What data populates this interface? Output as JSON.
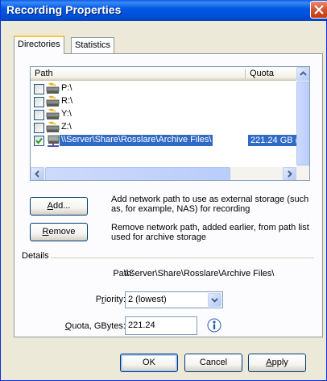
{
  "window": {
    "title": "Recording Properties"
  },
  "tabs": [
    {
      "label": "Directories",
      "active": true
    },
    {
      "label": "Statistics",
      "active": false
    }
  ],
  "list": {
    "columns": [
      "Path",
      "Quota"
    ],
    "rows": [
      {
        "path": "P:\\",
        "quota": "",
        "checked": false,
        "icon": "local-drive-icon",
        "selected": false
      },
      {
        "path": "R:\\",
        "quota": "",
        "checked": false,
        "icon": "local-drive-icon",
        "selected": false
      },
      {
        "path": "Y:\\",
        "quota": "",
        "checked": false,
        "icon": "local-drive-icon",
        "selected": false
      },
      {
        "path": "Z:\\",
        "quota": "",
        "checked": false,
        "icon": "local-drive-icon",
        "selected": false
      },
      {
        "path": "\\\\Server\\Share\\Rosslare\\Archive Files\\",
        "quota": "221.24 GB (✕",
        "checked": true,
        "icon": "network-drive-icon",
        "selected": true
      }
    ]
  },
  "actions": {
    "add_label": "Add...",
    "add_mnemonic": "A",
    "add_rest": "dd...",
    "add_description": "Add network path to use as external storage (such as, for example, NAS) for recording",
    "remove_label": "Remove",
    "remove_mnemonic": "R",
    "remove_rest": "emove",
    "remove_description": "Remove network path, added earlier, from path list used for archive storage"
  },
  "details": {
    "group_label": "Details",
    "path_label": "Path:",
    "path_value": "\\\\Server\\Share\\Rosslare\\Archive Files\\",
    "priority_label_pre": "P",
    "priority_label_mn": "r",
    "priority_label_post": "iority:",
    "priority_value": "2 (lowest)",
    "quota_label_mn": "Q",
    "quota_label_post": "uota, GBytes:",
    "quota_value": "221.24"
  },
  "footer": {
    "ok_label": "OK",
    "cancel_label": "Cancel",
    "apply_mnemonic": "A",
    "apply_rest": "pply"
  },
  "colors": {
    "title_bar": "#0058e4",
    "selection": "#316ac5",
    "face": "#ece9d8"
  }
}
